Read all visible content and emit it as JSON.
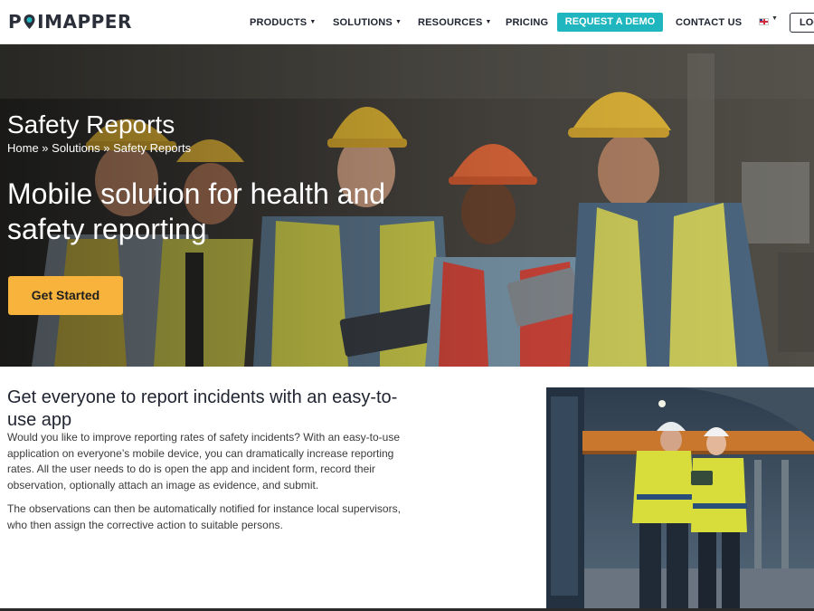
{
  "header": {
    "brand": {
      "part1": "P",
      "part2": "IMAPPER"
    },
    "nav": [
      {
        "label": "PRODUCTS",
        "dropdown": true
      },
      {
        "label": "SOLUTIONS",
        "dropdown": true
      },
      {
        "label": "RESOURCES",
        "dropdown": true
      },
      {
        "label": "PRICING",
        "dropdown": false
      }
    ],
    "demo_label": "REQUEST A DEMO",
    "contact_label": "CONTACT US",
    "login_label": "LOG"
  },
  "hero": {
    "title": "Safety Reports",
    "breadcrumb": {
      "home": "Home",
      "sep": " » ",
      "solutions": "Solutions",
      "current": "Safety Reports"
    },
    "heading": "Mobile solution for health and safety reporting",
    "cta_label": "Get Started"
  },
  "content": {
    "title": "Get everyone to report incidents with an easy-to-use app",
    "paragraph1": "Would you like to improve reporting rates of safety incidents? With an easy-to-use application on everyone’s mobile device, you can dramatically increase reporting rates. All the user needs to do is open the app and incident form, record their observation, optionally attach an image as evidence, and submit.",
    "paragraph2": "The observations can then be automatically notified for instance local supervisors, who then assign the corrective action to suitable persons."
  },
  "colors": {
    "accent_teal": "#1fb6bf",
    "cta_orange": "#f7b33b",
    "text_dark": "#1f2430"
  },
  "icons": [
    "map-pin-icon",
    "chevron-down-icon",
    "uk-flag-icon"
  ]
}
